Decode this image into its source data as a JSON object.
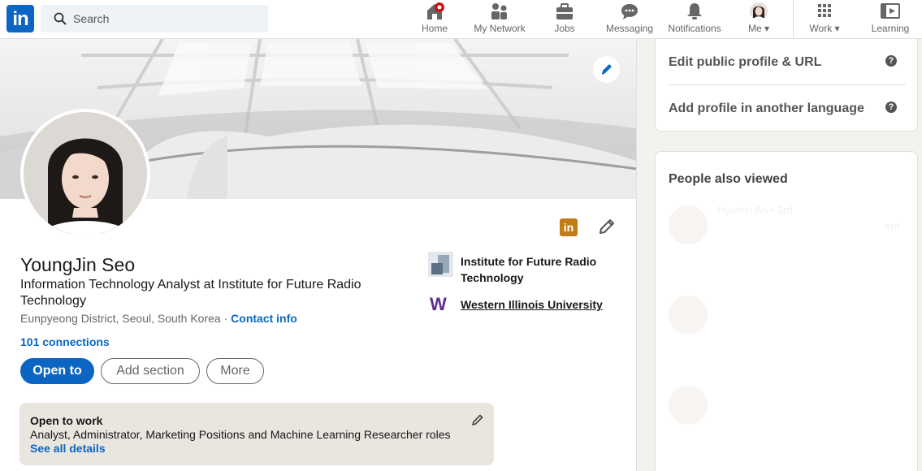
{
  "nav": {
    "search_placeholder": "Search",
    "items": [
      {
        "label": "Home",
        "icon": "home-icon",
        "badge": true
      },
      {
        "label": "My Network",
        "icon": "network-icon"
      },
      {
        "label": "Jobs",
        "icon": "briefcase-icon"
      },
      {
        "label": "Messaging",
        "icon": "messaging-icon"
      },
      {
        "label": "Notifications",
        "icon": "bell-icon"
      },
      {
        "label": "Me",
        "icon": "avatar-icon"
      },
      {
        "label": "Work",
        "icon": "grid-icon"
      },
      {
        "label": "Learning",
        "icon": "learning-icon"
      }
    ]
  },
  "profile": {
    "name": "YoungJin Seo",
    "headline": "Information Technology Analyst at Institute for Future Radio Technology",
    "location": "Eunpyeong District, Seoul, South Korea · ",
    "contact_label": "Contact info",
    "connections": "101 connections",
    "badge_letters": "in",
    "buttons": {
      "open_to": "Open to",
      "add_section": "Add section",
      "more": "More"
    },
    "experience": [
      {
        "name": "Institute for Future Radio Technology",
        "logo": "institute-logo"
      },
      {
        "name": "Western Illinois University",
        "logo": "W"
      }
    ],
    "open_to_work": {
      "title": "Open to work",
      "description": "Analyst, Administrator, Marketing Positions and Machine Learning Researcher roles",
      "link": "See all details"
    }
  },
  "rail": {
    "links": [
      "Edit public profile & URL",
      "Add profile in another language"
    ],
    "help_glyph": "?",
    "people_title": "People also viewed",
    "faded_name": "Hyunlin An • 3rd",
    "faded_fragment": "ent"
  },
  "colors": {
    "brand": "#0a66c2",
    "badge_gold": "#c37d16",
    "open_to_work_bg": "#e9e5df",
    "notification_dot": "#cc1016"
  }
}
